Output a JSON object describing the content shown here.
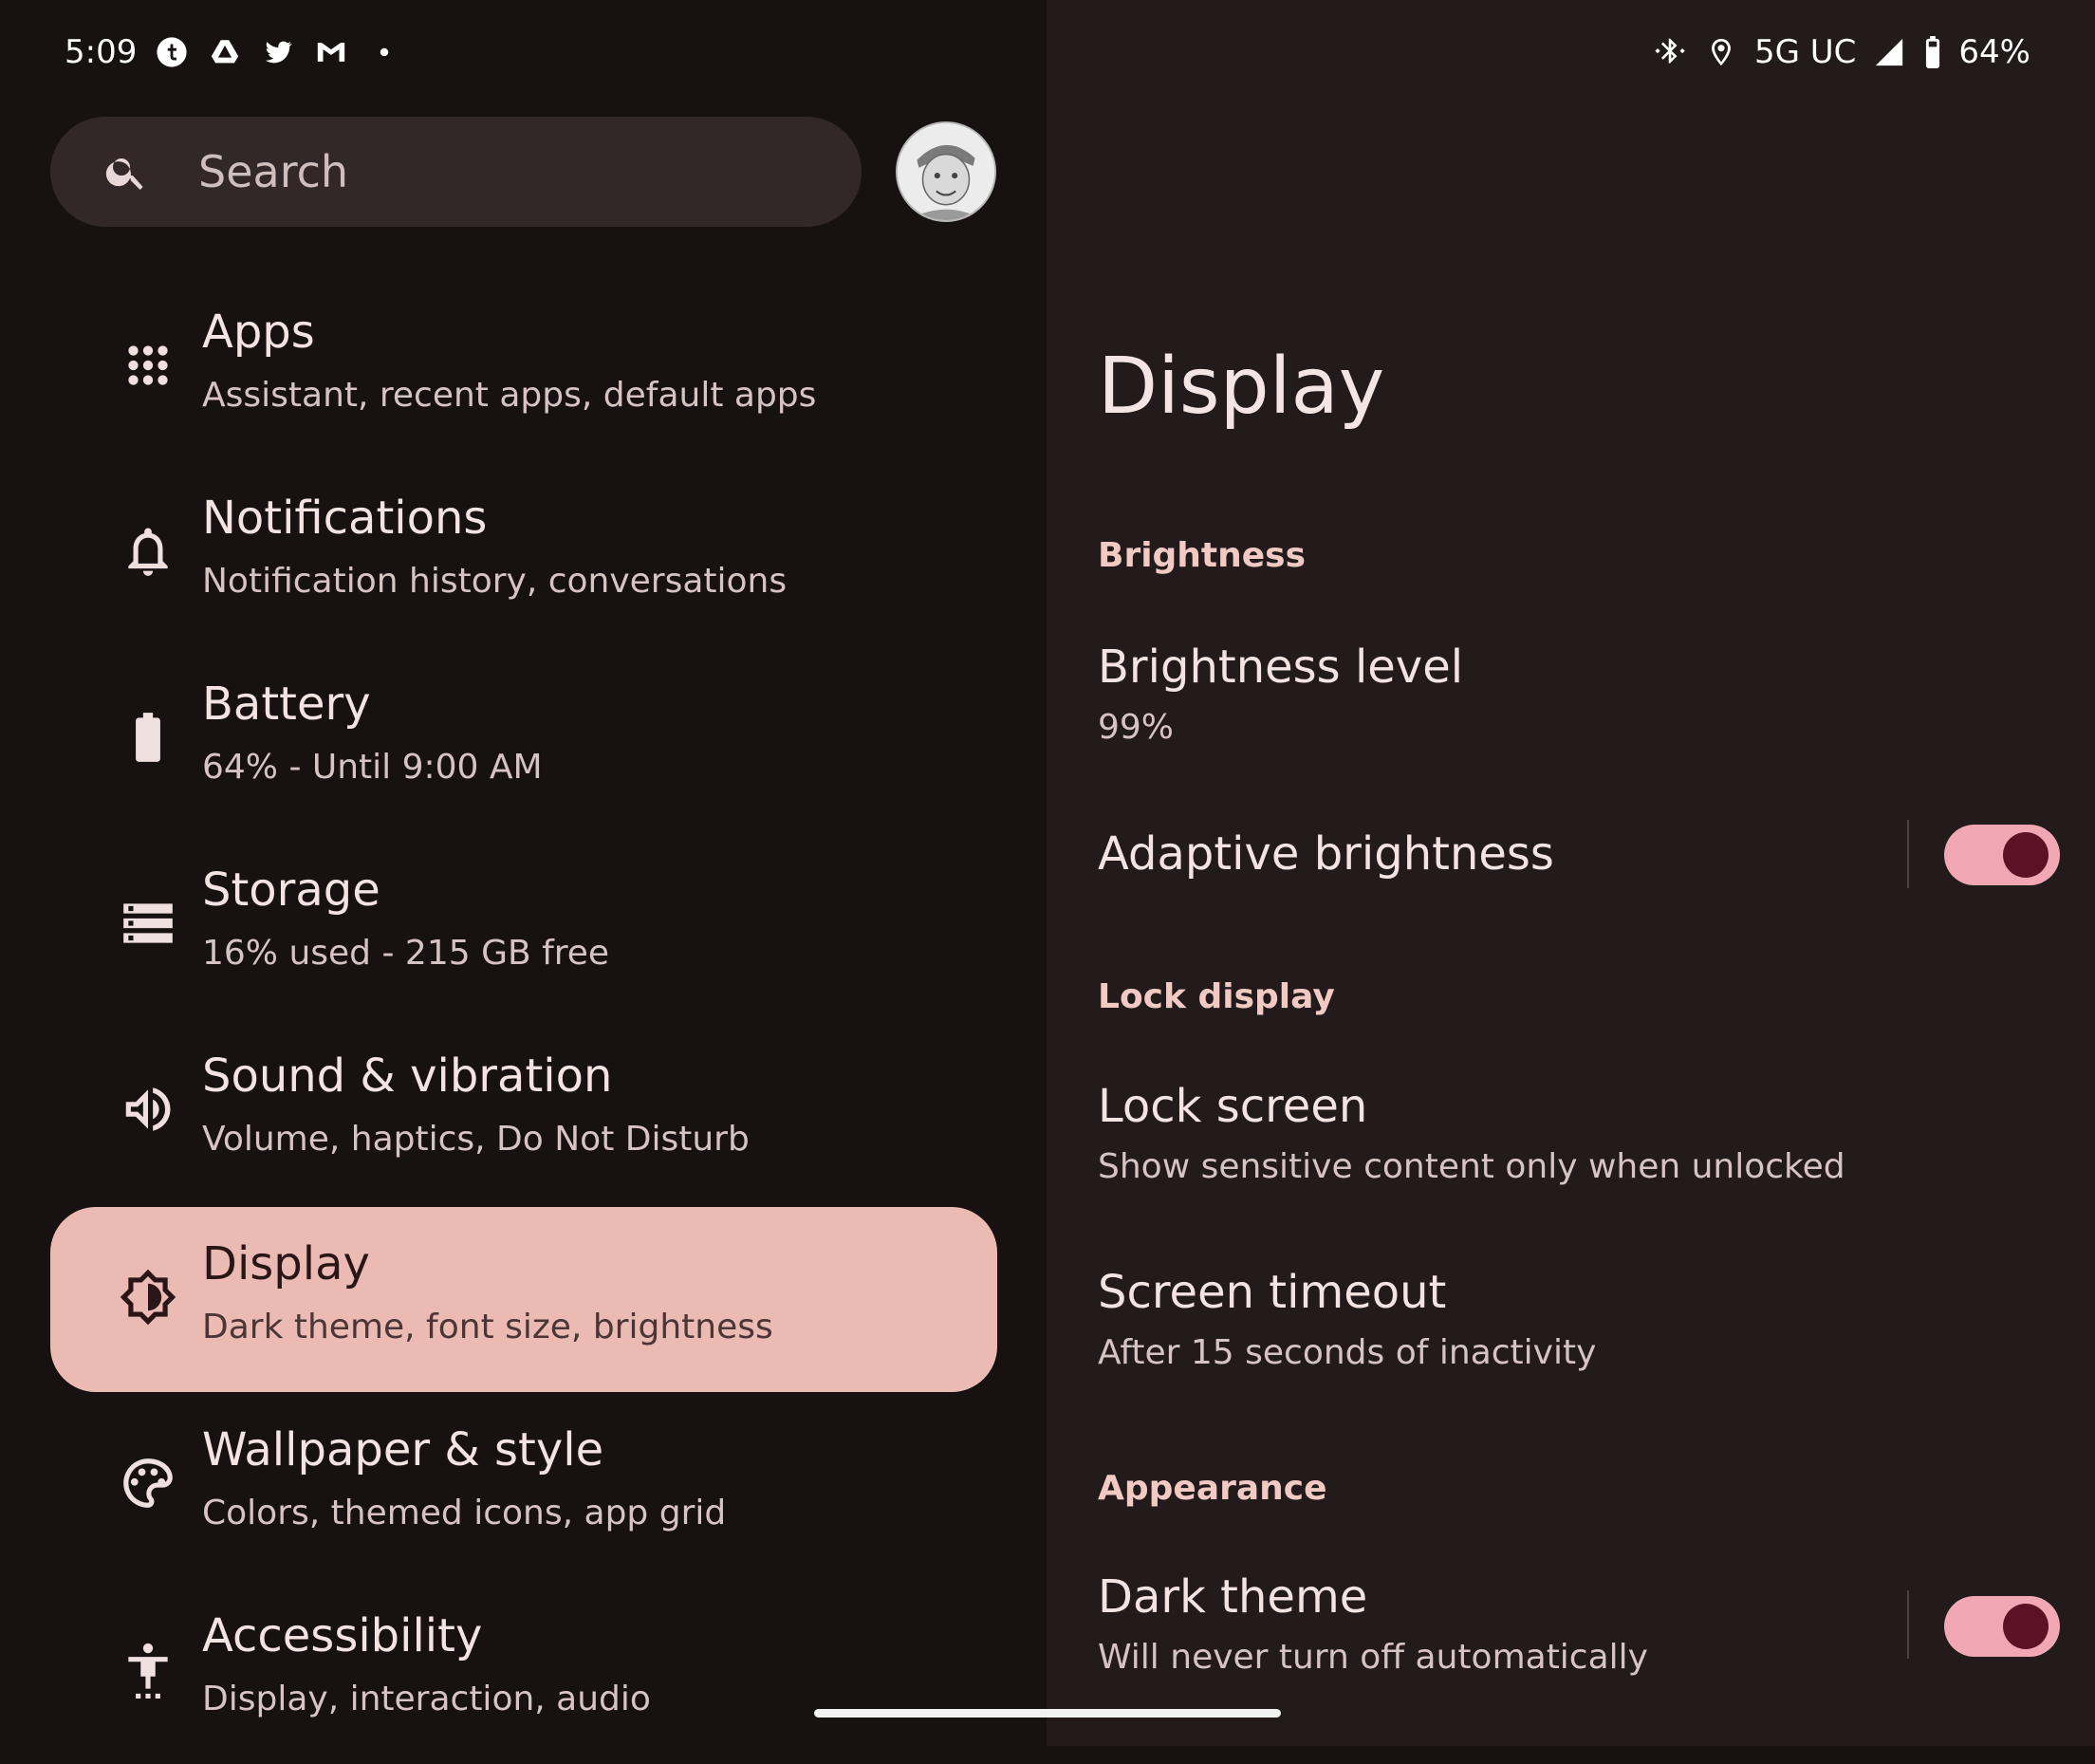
{
  "status_bar": {
    "time": "5:09",
    "left_icons": [
      "tumblr-icon",
      "drive-icon",
      "twitter-icon",
      "gmail-icon",
      "notification-dot-icon"
    ],
    "right_icons": [
      "bluetooth-icon",
      "location-icon",
      "signal-icon",
      "battery-icon"
    ],
    "network": "5G UC",
    "battery": "64%"
  },
  "search": {
    "placeholder": "Search"
  },
  "nav": {
    "items": [
      {
        "title": "Apps",
        "subtitle": "Assistant, recent apps, default apps",
        "icon": "apps-grid-icon"
      },
      {
        "title": "Notifications",
        "subtitle": "Notification history, conversations",
        "icon": "bell-icon"
      },
      {
        "title": "Battery",
        "subtitle": "64% - Until 9:00 AM",
        "icon": "battery-icon"
      },
      {
        "title": "Storage",
        "subtitle": "16% used - 215 GB free",
        "icon": "storage-icon"
      },
      {
        "title": "Sound & vibration",
        "subtitle": "Volume, haptics, Do Not Disturb",
        "icon": "volume-icon"
      },
      {
        "title": "Display",
        "subtitle": "Dark theme, font size, brightness",
        "icon": "brightness-icon",
        "selected": true
      },
      {
        "title": "Wallpaper & style",
        "subtitle": "Colors, themed icons, app grid",
        "icon": "palette-icon"
      },
      {
        "title": "Accessibility",
        "subtitle": "Display, interaction, audio",
        "icon": "accessibility-icon"
      }
    ]
  },
  "detail": {
    "title": "Display",
    "sections": {
      "brightness": "Brightness",
      "lock_display": "Lock display",
      "appearance": "Appearance"
    },
    "brightness_level": {
      "title": "Brightness level",
      "value": "99%"
    },
    "adaptive_brightness": {
      "title": "Adaptive brightness",
      "enabled": true
    },
    "lock_screen": {
      "title": "Lock screen",
      "subtitle": "Show sensitive content only when unlocked"
    },
    "screen_timeout": {
      "title": "Screen timeout",
      "subtitle": "After 15 seconds of inactivity"
    },
    "dark_theme": {
      "title": "Dark theme",
      "subtitle": "Will never turn off automatically",
      "enabled": true
    }
  },
  "colors": {
    "left_background": "#171112",
    "right_background": "#221a1b",
    "selected_item": "#ebbbb3",
    "section_header": "#f2c9c3",
    "toggle_track": "#f1a8b4",
    "toggle_thumb": "#5c1125"
  }
}
